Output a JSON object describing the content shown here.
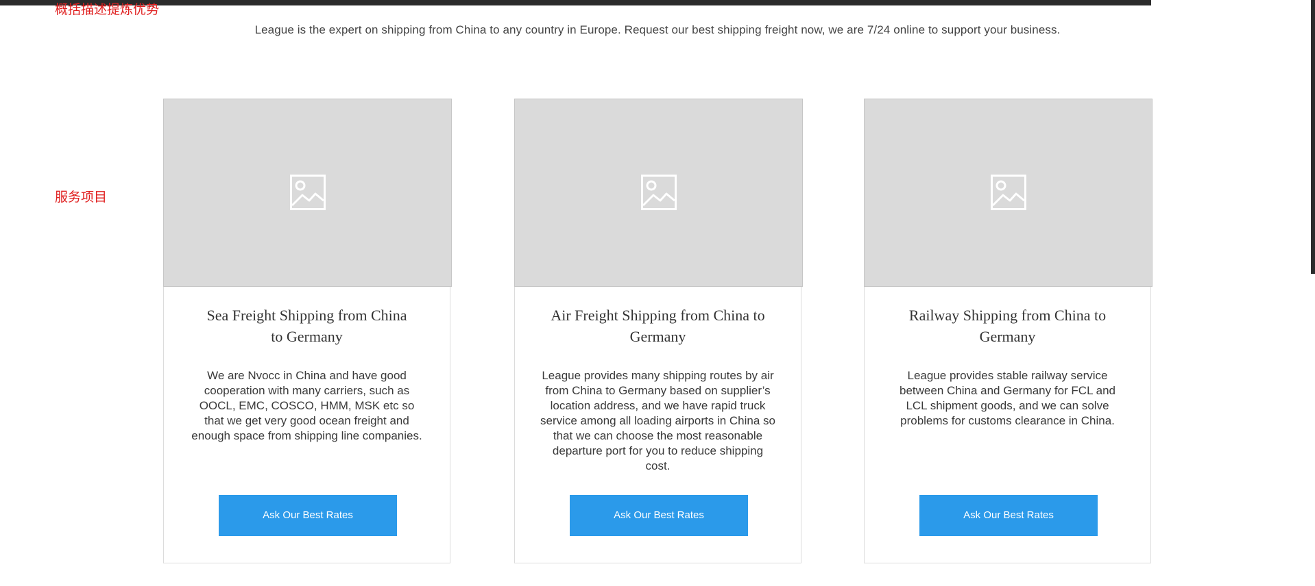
{
  "annotations": {
    "summary_note": "概括描述提炼优势",
    "services_note": "服务项目"
  },
  "intro": {
    "text": "League is the expert on shipping from China to any country in Europe. Request our best shipping freight now, we are 7/24 online to support your business."
  },
  "services": [
    {
      "image_icon": "image-placeholder-icon",
      "title_line1": "Sea Freight Shipping from China",
      "title_line2": "to Germany",
      "description": "We are Nvocc in China and have good cooperation with many carriers, such as OOCL, EMC, COSCO, HMM, MSK etc so that we get very good ocean freight and enough space from shipping line companies.",
      "button_label": "Ask Our Best Rates"
    },
    {
      "image_icon": "image-placeholder-icon",
      "title_line1": "Air Freight Shipping from China to",
      "title_line2": "Germany",
      "description": "League provides many shipping routes by air from China to Germany based on supplier’s location address, and we have rapid truck service among all loading airports in China so that we can choose the most reasonable departure port for you to reduce shipping cost.",
      "button_label": "Ask Our Best Rates"
    },
    {
      "image_icon": "image-placeholder-icon",
      "title_line1": "Railway Shipping from China to",
      "title_line2": "Germany",
      "description": "League provides stable railway service between China and Germany for FCL and LCL shipment goods, and we can solve problems for customs clearance in China.",
      "button_label": "Ask Our Best Rates"
    }
  ],
  "colors": {
    "button": "#2b9aea",
    "annotation": "#e02020",
    "placeholder": "#dadada"
  }
}
